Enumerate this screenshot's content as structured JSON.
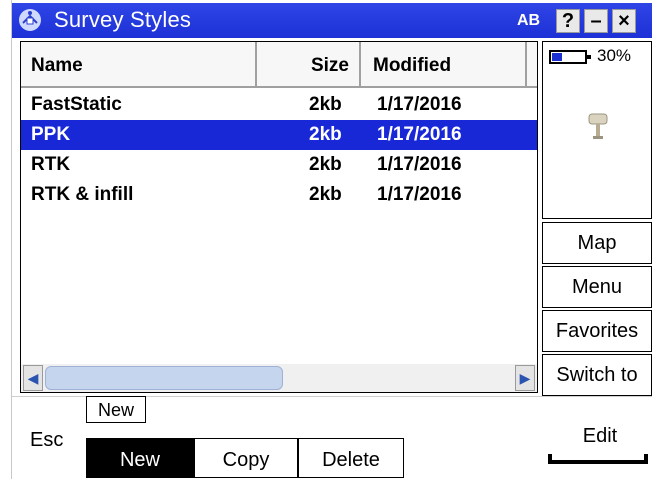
{
  "window": {
    "title": "Survey Styles",
    "icon": "satellite-icon",
    "input_mode": "AB",
    "help_label": "?",
    "minimize_label": "–",
    "close_label": "×"
  },
  "list": {
    "columns": [
      "Name",
      "Size",
      "Modified"
    ],
    "rows": [
      {
        "name": "FastStatic",
        "size": "2kb",
        "modified": "1/17/2016",
        "selected": false
      },
      {
        "name": "PPK",
        "size": "2kb",
        "modified": "1/17/2016",
        "selected": true
      },
      {
        "name": "RTK",
        "size": "2kb",
        "modified": "1/17/2016",
        "selected": false
      },
      {
        "name": "RTK & infill",
        "size": "2kb",
        "modified": "1/17/2016",
        "selected": false
      }
    ]
  },
  "status": {
    "battery_percent": "30%",
    "battery_level": 0.3,
    "receiver_icon": "antenna-icon"
  },
  "side_buttons": [
    "Map",
    "Menu",
    "Favorites",
    "Switch to"
  ],
  "bottom": {
    "esc_label": "Esc",
    "tooltip": "New",
    "buttons": [
      "New",
      "Copy",
      "Delete"
    ],
    "edit_label": "Edit"
  },
  "colors": {
    "titlebar": "#1d31d6",
    "selection": "#1928d6"
  }
}
